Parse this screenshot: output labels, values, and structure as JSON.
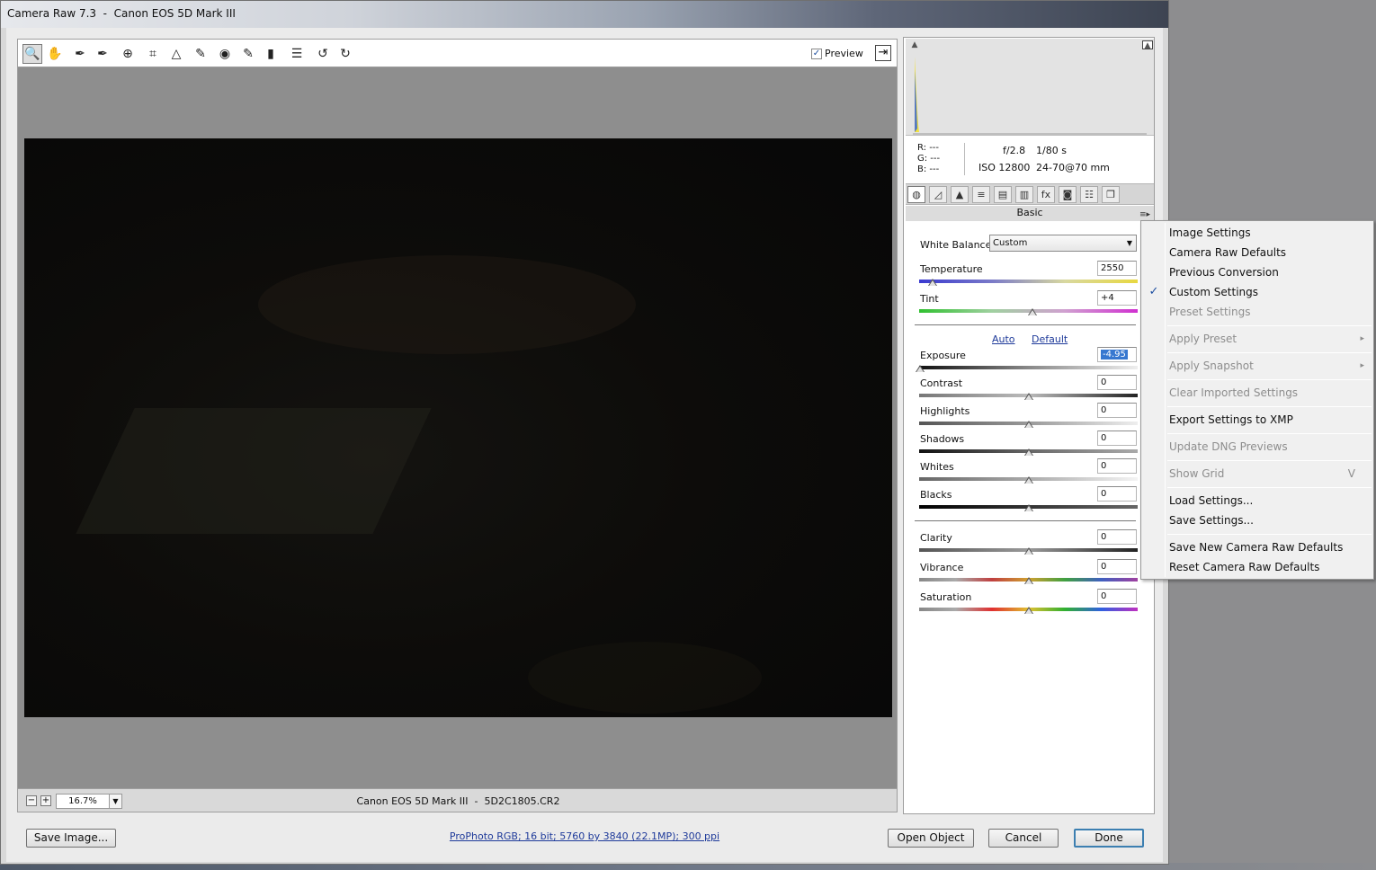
{
  "window": {
    "title": "Camera Raw 7.3  -  Canon EOS 5D Mark III"
  },
  "toolbar": {
    "tools": [
      {
        "name": "zoom-tool",
        "glyph": "🔍"
      },
      {
        "name": "hand-tool",
        "glyph": "✋"
      },
      {
        "name": "white-balance-tool",
        "glyph": "✒"
      },
      {
        "name": "color-sampler-tool",
        "glyph": "✒"
      },
      {
        "name": "targeted-adjustment-tool",
        "glyph": "⊕"
      },
      {
        "name": "crop-tool",
        "glyph": "⌗"
      },
      {
        "name": "straighten-tool",
        "glyph": "△"
      },
      {
        "name": "spot-removal-tool",
        "glyph": "✎"
      },
      {
        "name": "red-eye-tool",
        "glyph": "◉"
      },
      {
        "name": "adjustment-brush-tool",
        "glyph": "✎"
      },
      {
        "name": "graduated-filter-tool",
        "glyph": "▮"
      },
      {
        "name": "preferences",
        "glyph": "☰"
      },
      {
        "name": "rotate-left",
        "glyph": "↺"
      },
      {
        "name": "rotate-right",
        "glyph": "↻"
      }
    ],
    "preview_label": "Preview",
    "preview_checked": "✓"
  },
  "statusbar": {
    "zoom_minus": "−",
    "zoom_plus": "+",
    "zoom_value": "16.7%",
    "zoom_dropdown": "▼",
    "filename": "Canon EOS 5D Mark III  -  5D2C1805.CR2"
  },
  "info": {
    "r": "R:  ---",
    "g": "G:  ---",
    "b": "B:  ---",
    "aperture": "f/2.8",
    "shutter": "1/80 s",
    "iso": "ISO 12800",
    "lens": "24-70@70 mm"
  },
  "histogram": {
    "clip_shadow": "▲",
    "clip_highlight": "▲"
  },
  "panel_tabs": [
    {
      "name": "basic-tab",
      "glyph": "◍"
    },
    {
      "name": "tone-curve-tab",
      "glyph": "◿"
    },
    {
      "name": "detail-tab",
      "glyph": "▲"
    },
    {
      "name": "hsl-tab",
      "glyph": "≡"
    },
    {
      "name": "split-toning-tab",
      "glyph": "▤"
    },
    {
      "name": "lens-corrections-tab",
      "glyph": "▥"
    },
    {
      "name": "effects-tab",
      "glyph": "fx"
    },
    {
      "name": "camera-calibration-tab",
      "glyph": "◙"
    },
    {
      "name": "presets-tab",
      "glyph": "☷"
    },
    {
      "name": "snapshots-tab",
      "glyph": "❐"
    }
  ],
  "basic": {
    "title": "Basic",
    "menu_icon": "≡▸",
    "white_balance_label": "White Balance:",
    "white_balance_value": "Custom",
    "auto_label": "Auto",
    "default_label": "Default",
    "sliders": {
      "temperature": {
        "label": "Temperature",
        "value": "2550",
        "position": 0.06
      },
      "tint": {
        "label": "Tint",
        "value": "+4",
        "position": 0.52
      },
      "exposure": {
        "label": "Exposure",
        "value": "-4.95",
        "position": 0.005
      },
      "contrast": {
        "label": "Contrast",
        "value": "0",
        "position": 0.5
      },
      "highlights": {
        "label": "Highlights",
        "value": "0",
        "position": 0.5
      },
      "shadows": {
        "label": "Shadows",
        "value": "0",
        "position": 0.5
      },
      "whites": {
        "label": "Whites",
        "value": "0",
        "position": 0.5
      },
      "blacks": {
        "label": "Blacks",
        "value": "0",
        "position": 0.5
      },
      "clarity": {
        "label": "Clarity",
        "value": "0",
        "position": 0.5
      },
      "vibrance": {
        "label": "Vibrance",
        "value": "0",
        "position": 0.5
      },
      "saturation": {
        "label": "Saturation",
        "value": "0",
        "position": 0.5
      }
    }
  },
  "buttons": {
    "save_image": "Save Image...",
    "workflow": "ProPhoto RGB; 16 bit; 5760 by 3840 (22.1MP); 300 ppi",
    "open_object": "Open Object",
    "cancel": "Cancel",
    "done": "Done"
  },
  "menu": {
    "checkmark": "✓",
    "items": [
      {
        "label": "Image Settings",
        "disabled": false
      },
      {
        "label": "Camera Raw Defaults",
        "disabled": false
      },
      {
        "label": "Previous Conversion",
        "disabled": false
      },
      {
        "label": "Custom Settings",
        "disabled": false,
        "checked": true
      },
      {
        "label": "Preset Settings",
        "disabled": true
      },
      {
        "label": "Apply Preset",
        "disabled": true,
        "submenu": "▸"
      },
      {
        "label": "Apply Snapshot",
        "disabled": true,
        "submenu": "▸"
      },
      {
        "label": "Clear Imported Settings",
        "disabled": true
      },
      {
        "label": "Export Settings to XMP",
        "disabled": false
      },
      {
        "label": "Update DNG Previews",
        "disabled": true
      },
      {
        "label": "Show Grid",
        "disabled": true,
        "shortcut": "V"
      },
      {
        "label": "Load Settings...",
        "disabled": false
      },
      {
        "label": "Save Settings...",
        "disabled": false
      },
      {
        "label": "Save New Camera Raw Defaults",
        "disabled": false
      },
      {
        "label": "Reset Camera Raw Defaults",
        "disabled": false
      }
    ]
  }
}
